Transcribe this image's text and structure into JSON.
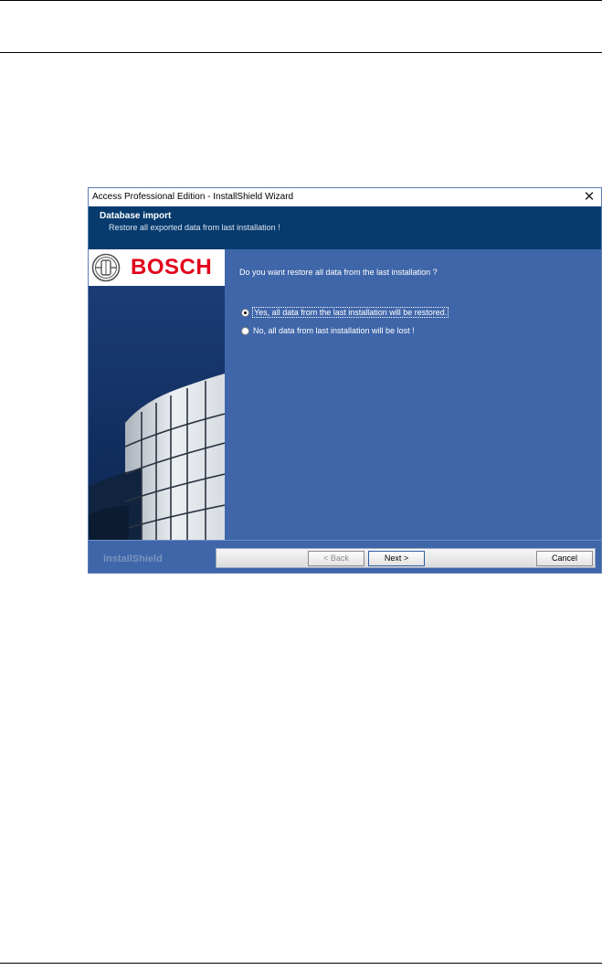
{
  "window": {
    "title": "Access Professional Edition - InstallShield Wizard",
    "close_glyph": "✕"
  },
  "header": {
    "title": "Database import",
    "subtitle": "Restore all exported data from last installation !"
  },
  "brand_panel": {
    "logo_text": "BOSCH",
    "logo_icon": "bosch-armature-icon"
  },
  "content": {
    "question": "Do you want restore all data from the last installation ?",
    "options": [
      {
        "label": "Yes, all data from the last installation will be restored.",
        "checked": true
      },
      {
        "label": "No, all data from last installation will be lost !",
        "checked": false
      }
    ]
  },
  "footer": {
    "brand": "InstallShield",
    "back_label": "< Back",
    "next_label": "Next >",
    "cancel_label": "Cancel"
  },
  "colors": {
    "accent_blue": "#3f66a9",
    "header_navy": "#073b6e",
    "bosch_red": "#e2001a"
  }
}
